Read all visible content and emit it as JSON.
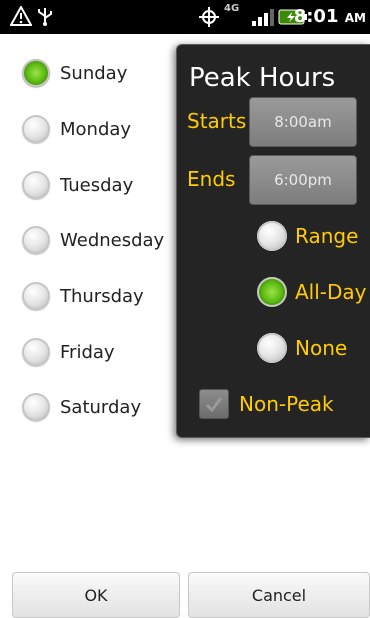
{
  "status_bar": {
    "time": "8:01",
    "ampm": "AM",
    "network": "4G",
    "icons": [
      "signal-warning-icon",
      "usb-icon",
      "gps-icon",
      "network-4g-icon",
      "signal-bars-icon",
      "battery-charging-icon"
    ]
  },
  "days": [
    {
      "label": "Sunday",
      "selected": true
    },
    {
      "label": "Monday",
      "selected": false
    },
    {
      "label": "Tuesday",
      "selected": false
    },
    {
      "label": "Wednesday",
      "selected": false
    },
    {
      "label": "Thursday",
      "selected": false
    },
    {
      "label": "Friday",
      "selected": false
    },
    {
      "label": "Saturday",
      "selected": false
    }
  ],
  "peak_panel": {
    "title": "Peak Hours",
    "starts_label": "Starts",
    "starts_value": "8:00am",
    "ends_label": "Ends",
    "ends_value": "6:00pm",
    "options": [
      {
        "label": "Range",
        "selected": false
      },
      {
        "label": "All-Day",
        "selected": true
      },
      {
        "label": "None",
        "selected": false
      }
    ],
    "non_peak_label": "Non-Peak",
    "non_peak_checked": false
  },
  "buttons": {
    "ok": "OK",
    "cancel": "Cancel"
  },
  "colors": {
    "accent_yellow": "#ffcc00",
    "panel_bg": "#242424",
    "radio_green": "#5dbb12"
  }
}
